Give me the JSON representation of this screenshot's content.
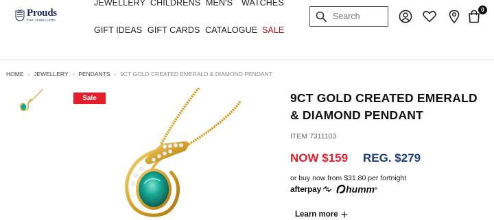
{
  "header": {
    "logo": {
      "name": "Prouds",
      "sub": "THE JEWELLERS"
    },
    "nav_row1": [
      "JEWELLERY",
      "CHILDRENS",
      "MEN'S",
      "WATCHES"
    ],
    "nav_row2": [
      "GIFT IDEAS",
      "GIFT CARDS",
      "CATALOGUE",
      "SALE"
    ],
    "search": {
      "placeholder": "Search"
    },
    "icons": [
      "account-icon",
      "wishlist-icon",
      "store-locator-icon",
      "cart-icon"
    ],
    "cart_count": "0"
  },
  "breadcrumb": [
    "HOME",
    "JEWELLERY",
    "PENDANTS",
    "9CT GOLD CREATED EMERALD & DIAMOND PENDANT"
  ],
  "gallery": {
    "badge": "Sale"
  },
  "product": {
    "title": "9CT GOLD CREATED EMERALD & DIAMOND PENDANT",
    "item": "ITEM 7311103",
    "price_now": "NOW $159",
    "price_reg": "REG. $279",
    "bnpl_text": "or buy now from $31.80 per fortnight",
    "afterpay": "afterpay",
    "humm": "humm",
    "learn_more": "Learn more"
  },
  "colors": {
    "sale_red": "#e41e2b",
    "reg_blue": "#1d3c7c",
    "brand_navy": "#1d2a5c"
  }
}
